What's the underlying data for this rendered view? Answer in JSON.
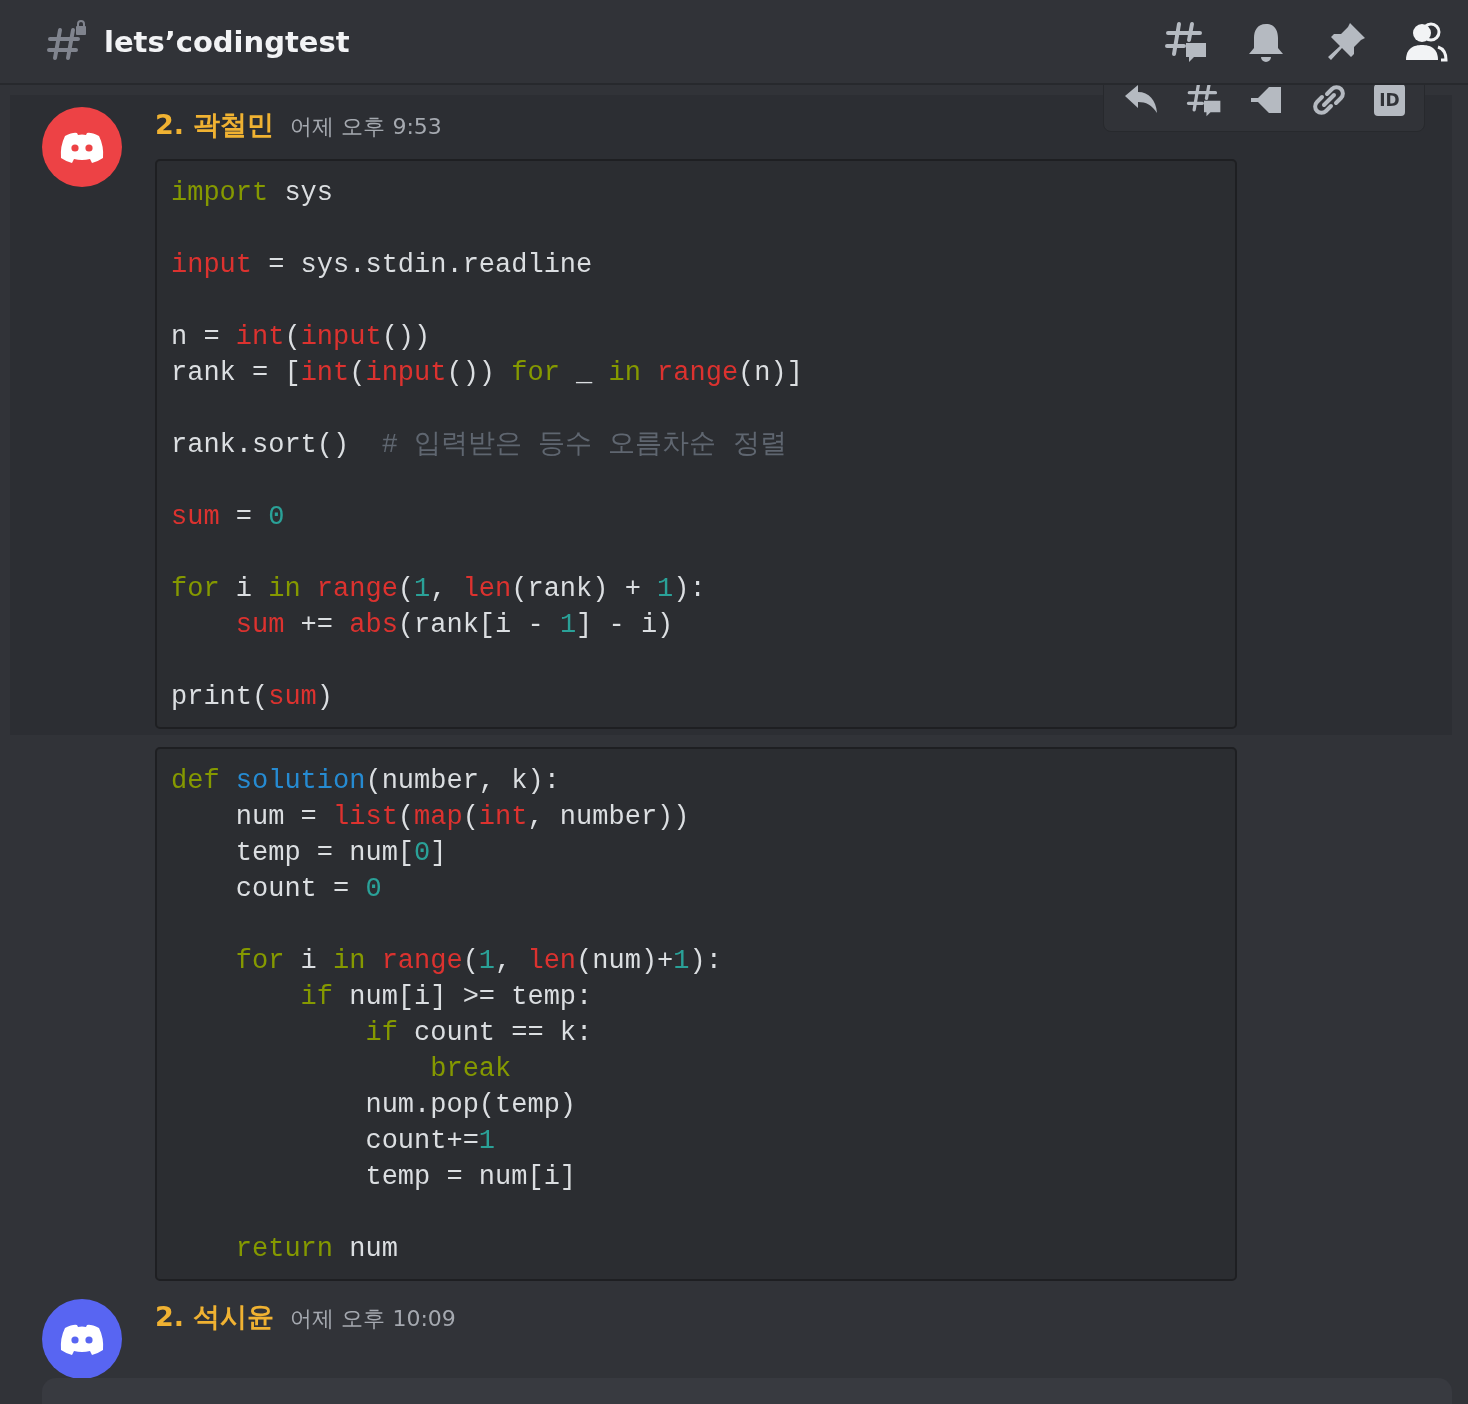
{
  "channel": {
    "name": "lets’codingtest"
  },
  "message_toolbar": {
    "id_label": "ID"
  },
  "messages": [
    {
      "kind": "header",
      "hovered": true,
      "color": "#ed4245",
      "author": "2. 곽철민",
      "timestamp": "어제 오후 9:53",
      "code": [
        {
          "lines": [
            {
              "tokens": [
                {
                  "kind": "keyword",
                  "text": "import"
                },
                {
                  "kind": "plain",
                  "text": " sys"
                }
              ]
            }
          ]
        },
        {
          "lines": [
            {
              "tokens": [
                {
                  "kind": "builtin",
                  "text": "input"
                },
                {
                  "kind": "plain",
                  "text": " = sys.stdin.readline"
                }
              ]
            }
          ]
        },
        {
          "lines": [
            {
              "tokens": [
                {
                  "kind": "plain",
                  "text": "n = "
                },
                {
                  "kind": "builtin",
                  "text": "int"
                },
                {
                  "kind": "plain",
                  "text": "("
                },
                {
                  "kind": "builtin",
                  "text": "input"
                },
                {
                  "kind": "plain",
                  "text": "())"
                }
              ]
            },
            {
              "tokens": [
                {
                  "kind": "plain",
                  "text": "rank = ["
                },
                {
                  "kind": "builtin",
                  "text": "int"
                },
                {
                  "kind": "plain",
                  "text": "("
                },
                {
                  "kind": "builtin",
                  "text": "input"
                },
                {
                  "kind": "plain",
                  "text": "()) "
                },
                {
                  "kind": "keyword",
                  "text": "for"
                },
                {
                  "kind": "plain",
                  "text": " _ "
                },
                {
                  "kind": "keyword",
                  "text": "in"
                },
                {
                  "kind": "builtin",
                  "text": " range"
                },
                {
                  "kind": "plain",
                  "text": "(n)]"
                }
              ]
            }
          ]
        },
        {
          "lines": [
            {
              "tokens": [
                {
                  "kind": "plain",
                  "text": "rank.sort()  "
                },
                {
                  "kind": "comment",
                  "text": "# 입력받은 등수 오름차순 정렬"
                }
              ]
            }
          ]
        },
        {
          "lines": [
            {
              "tokens": [
                {
                  "kind": "builtin",
                  "text": "sum"
                },
                {
                  "kind": "plain",
                  "text": " = "
                },
                {
                  "kind": "number",
                  "text": "0"
                }
              ]
            }
          ]
        },
        {
          "lines": [
            {
              "tokens": [
                {
                  "kind": "keyword",
                  "text": "for"
                },
                {
                  "kind": "plain",
                  "text": " i "
                },
                {
                  "kind": "keyword",
                  "text": "in"
                },
                {
                  "kind": "builtin",
                  "text": " range"
                },
                {
                  "kind": "plain",
                  "text": "("
                },
                {
                  "kind": "number",
                  "text": "1"
                },
                {
                  "kind": "plain",
                  "text": ", "
                },
                {
                  "kind": "builtin",
                  "text": "len"
                },
                {
                  "kind": "plain",
                  "text": "(rank) + "
                },
                {
                  "kind": "number",
                  "text": "1"
                },
                {
                  "kind": "plain",
                  "text": "):"
                }
              ]
            },
            {
              "tokens": [
                {
                  "kind": "builtin",
                  "text": "    sum"
                },
                {
                  "kind": "plain",
                  "text": " += "
                },
                {
                  "kind": "builtin",
                  "text": "abs"
                },
                {
                  "kind": "plain",
                  "text": "(rank[i - "
                },
                {
                  "kind": "number",
                  "text": "1"
                },
                {
                  "kind": "plain",
                  "text": "] - i)"
                }
              ]
            }
          ]
        },
        {
          "lines": [
            {
              "tokens": [
                {
                  "kind": "plain",
                  "text": "print("
                },
                {
                  "kind": "builtin",
                  "text": "sum"
                },
                {
                  "kind": "plain",
                  "text": ")"
                }
              ]
            }
          ]
        }
      ]
    },
    {
      "kind": "continuation",
      "hovered": false,
      "code": [
        {
          "lines": [
            {
              "tokens": [
                {
                  "kind": "keyword",
                  "text": "def"
                },
                {
                  "kind": "function",
                  "text": " solution"
                },
                {
                  "kind": "plain",
                  "text": "(number, k):"
                }
              ]
            },
            {
              "tokens": [
                {
                  "kind": "plain",
                  "text": "    num = "
                },
                {
                  "kind": "builtin",
                  "text": "list"
                },
                {
                  "kind": "plain",
                  "text": "("
                },
                {
                  "kind": "builtin",
                  "text": "map"
                },
                {
                  "kind": "plain",
                  "text": "("
                },
                {
                  "kind": "builtin",
                  "text": "int"
                },
                {
                  "kind": "plain",
                  "text": ", number))"
                }
              ]
            },
            {
              "tokens": [
                {
                  "kind": "plain",
                  "text": "    temp = num["
                },
                {
                  "kind": "number",
                  "text": "0"
                },
                {
                  "kind": "plain",
                  "text": "]"
                }
              ]
            },
            {
              "tokens": [
                {
                  "kind": "plain",
                  "text": "    count = "
                },
                {
                  "kind": "number",
                  "text": "0"
                }
              ]
            }
          ]
        },
        {
          "lines": [
            {
              "tokens": [
                {
                  "kind": "keyword",
                  "text": "    for"
                },
                {
                  "kind": "plain",
                  "text": " i "
                },
                {
                  "kind": "keyword",
                  "text": "in"
                },
                {
                  "kind": "builtin",
                  "text": " range"
                },
                {
                  "kind": "plain",
                  "text": "("
                },
                {
                  "kind": "number",
                  "text": "1"
                },
                {
                  "kind": "plain",
                  "text": ", "
                },
                {
                  "kind": "builtin",
                  "text": "len"
                },
                {
                  "kind": "plain",
                  "text": "(num)+"
                },
                {
                  "kind": "number",
                  "text": "1"
                },
                {
                  "kind": "plain",
                  "text": "):"
                }
              ]
            },
            {
              "tokens": [
                {
                  "kind": "keyword",
                  "text": "        if"
                },
                {
                  "kind": "plain",
                  "text": " num[i] >= temp:"
                }
              ]
            },
            {
              "tokens": [
                {
                  "kind": "keyword",
                  "text": "            if"
                },
                {
                  "kind": "plain",
                  "text": " count == k:"
                }
              ]
            },
            {
              "tokens": [
                {
                  "kind": "keyword",
                  "text": "                break"
                }
              ]
            },
            {
              "tokens": [
                {
                  "kind": "plain",
                  "text": "            num.pop(temp)"
                }
              ]
            },
            {
              "tokens": [
                {
                  "kind": "plain",
                  "text": "            count+="
                },
                {
                  "kind": "number",
                  "text": "1"
                }
              ]
            },
            {
              "tokens": [
                {
                  "kind": "plain",
                  "text": "            temp = num[i]"
                }
              ]
            }
          ]
        },
        {
          "lines": [
            {
              "tokens": [
                {
                  "kind": "keyword",
                  "text": "    return"
                },
                {
                  "kind": "plain",
                  "text": " num"
                }
              ]
            }
          ]
        }
      ]
    },
    {
      "kind": "header",
      "hovered": false,
      "color": "#5865f2",
      "author": "2. 석시윤",
      "timestamp": "어제 오후 10:09"
    }
  ]
}
